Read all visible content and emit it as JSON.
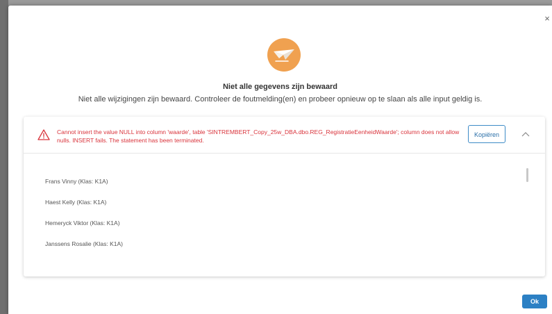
{
  "dialog": {
    "close_label": "×",
    "title": "Niet alle gegevens zijn bewaard",
    "subtitle": "Niet alle wijzigingen zijn bewaard. Controleer de foutmelding(en) en probeer opnieuw op te slaan als alle input geldig is.",
    "hero_icon": "paper-plane-icon",
    "ok_label": "Ok"
  },
  "error": {
    "icon": "warning-triangle-icon",
    "message": "Cannot insert the value NULL into column 'waarde', table 'SINTREMBERT_Copy_25w_DBA.dbo.REG_RegistratieEenheidWaarde'; column does not allow nulls. INSERT fails. The statement has been terminated.",
    "copy_label": "Kopiëren",
    "collapse_icon": "chevron-up-icon"
  },
  "students": [
    {
      "label": "Frans Vinny (Klas: K1A)"
    },
    {
      "label": "Haest Kelly (Klas: K1A)"
    },
    {
      "label": "Hemeryck Viktor (Klas: K1A)"
    },
    {
      "label": "Janssens Rosalie (Klas: K1A)"
    }
  ],
  "colors": {
    "accent": "#2c80c4",
    "error": "#d9333b",
    "hero": "#f0a150"
  }
}
